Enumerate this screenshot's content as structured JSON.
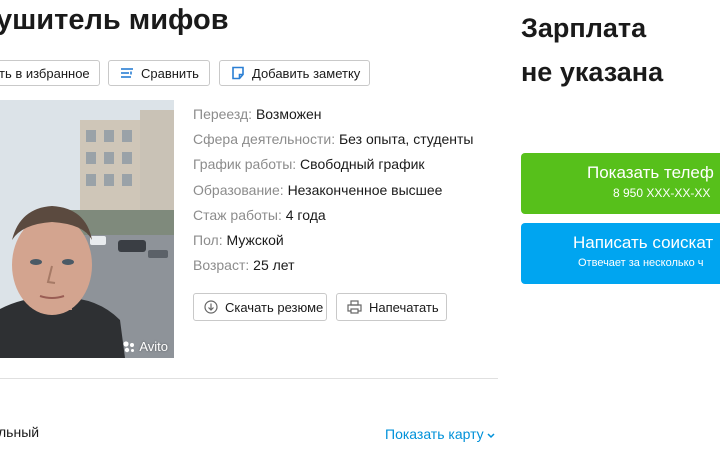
{
  "page": {
    "title": "ушитель мифов"
  },
  "actions": {
    "favorite_label": "ть в избранное",
    "compare_label": "Сравнить",
    "add_note_label": "Добавить заметку"
  },
  "photo": {
    "watermark": "Avito"
  },
  "details": [
    {
      "key": "Переезд:",
      "value": "Возможен"
    },
    {
      "key": "Сфера деятельности:",
      "value": "Без опыта, студенты"
    },
    {
      "key": "График работы:",
      "value": "Свободный график"
    },
    {
      "key": "Образование:",
      "value": "Незаконченное высшее"
    },
    {
      "key": "Стаж работы:",
      "value": "4 года"
    },
    {
      "key": "Пол:",
      "value": "Мужской"
    },
    {
      "key": "Возраст:",
      "value": "25 лет"
    }
  ],
  "resume_actions": {
    "download_label": "Скачать резюме",
    "print_label": "Напечатать"
  },
  "location": {
    "address_text": "льный",
    "show_map_label": "Показать карту"
  },
  "sidebar": {
    "salary_line1": "Зарплата",
    "salary_line2": "не указана",
    "phone_button": {
      "label": "Показать телеф",
      "number": "8 950 XXX-XX-XX"
    },
    "write_button": {
      "label": "Написать соискат",
      "sublabel": "Отвечает за несколько ч"
    }
  },
  "colors": {
    "link": "#0091d9",
    "green_button": "#57c01b",
    "blue_button": "#00a5f0"
  }
}
